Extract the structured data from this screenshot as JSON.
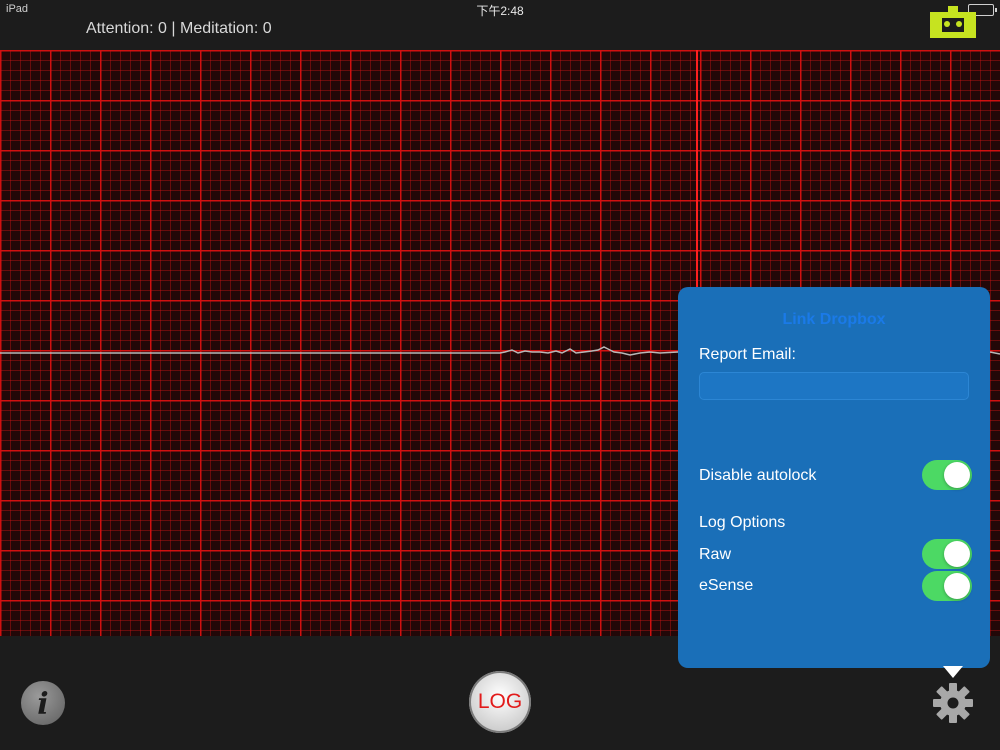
{
  "status_bar": {
    "device": "iPad",
    "time": "下午2:48"
  },
  "header": {
    "readout": "Attention: 0 | Meditation: 0"
  },
  "settings_panel": {
    "link_dropbox": "Link Dropbox",
    "report_email_label": "Report Email:",
    "report_email_value": "",
    "disable_autolock_label": "Disable autolock",
    "disable_autolock_on": true,
    "log_options_label": "Log Options",
    "raw_label": "Raw",
    "raw_on": true,
    "esense_label": "eSense",
    "esense_on": true
  },
  "toolbar": {
    "info_glyph": "i",
    "log_label": "LOG"
  },
  "colors": {
    "grid_major": "#d21010",
    "grid_background": "#220808",
    "panel": "#1a6fb8",
    "toggle_on": "#4cd964",
    "headset_icon": "#c6e320"
  },
  "icons": [
    "headset-icon",
    "info-icon",
    "gear-icon",
    "battery-icon"
  ]
}
